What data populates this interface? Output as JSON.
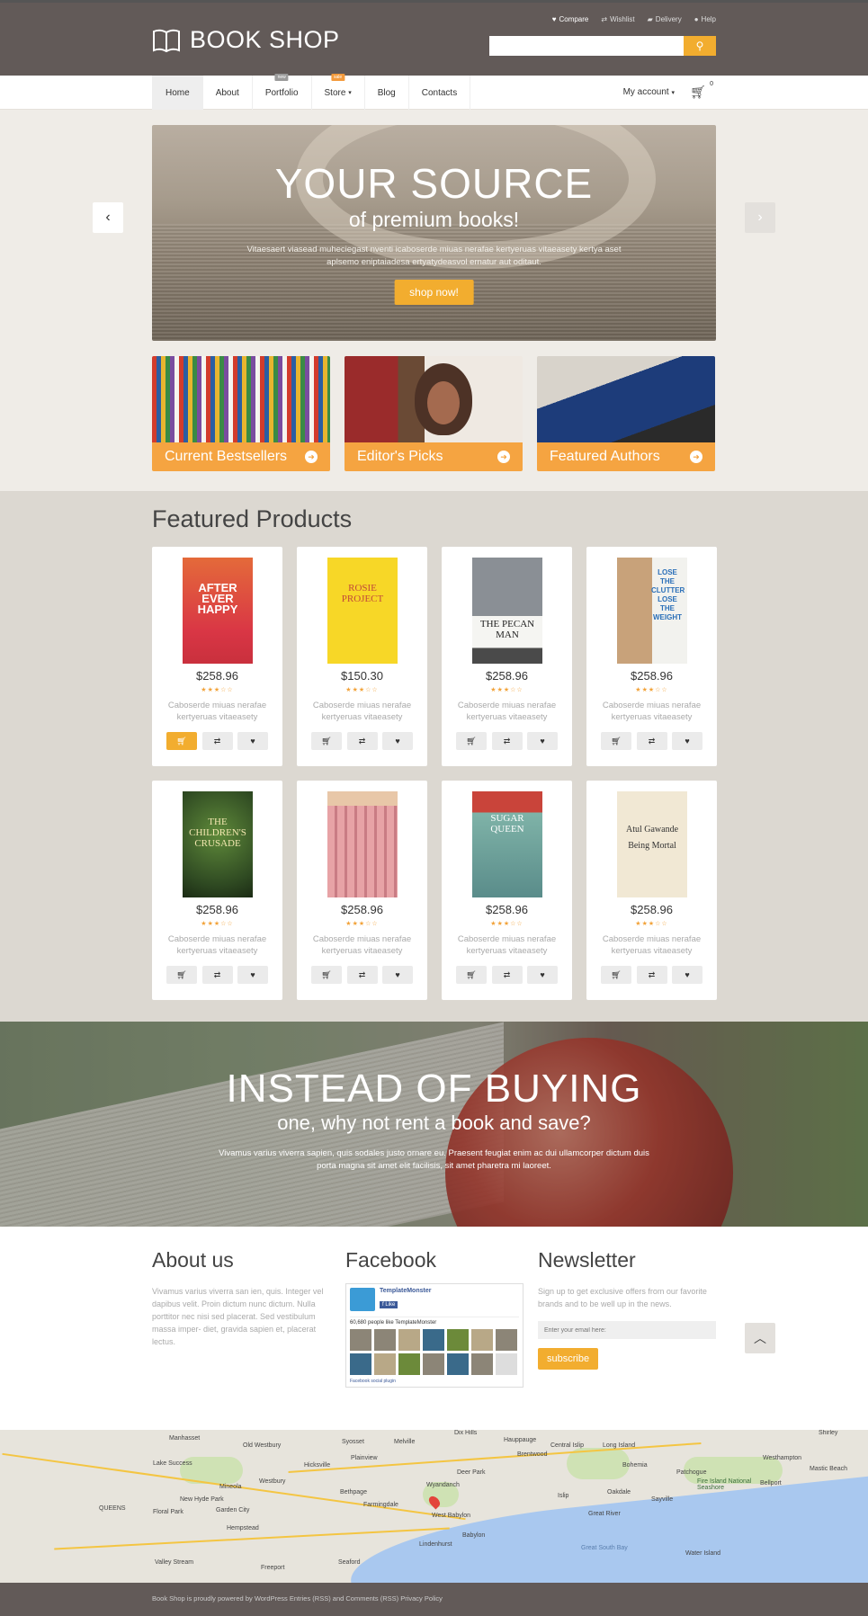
{
  "header": {
    "logo": "BOOK SHOP",
    "toplinks": [
      "Compare",
      "Wishlist",
      "Delivery",
      "Help"
    ],
    "search_placeholder": ""
  },
  "nav": {
    "items": [
      "Home",
      "About",
      "Portfolio",
      "Store",
      "Blog",
      "Contacts"
    ],
    "portfolio_badge": "new",
    "store_badge": "sale",
    "my_account": "My account",
    "cart_count": "0"
  },
  "hero": {
    "title": "YOUR SOURCE",
    "subtitle": "of premium books!",
    "text": "Vitaesaert viasead muheciegast nventi icaboserde miuas nerafae kertyeruas vitaeasety kertya aset aplsemo eniptaiadesa ertyatydeasvol ernatur aut oditaut.",
    "button": "shop now!"
  },
  "categories": [
    "Current  Bestsellers",
    "Editor's Picks",
    "Featured Authors"
  ],
  "featured": {
    "title": "Featured Products",
    "products": [
      {
        "cover": "AFTER EVER HAPPY",
        "price": "$258.96",
        "desc": "Caboserde miuas nerafae kertyeruas vitaeasety"
      },
      {
        "cover": "ROSIE PROJECT",
        "price": "$150.30",
        "desc": "Caboserde miuas nerafae kertyeruas vitaeasety"
      },
      {
        "cover": "THE PECAN MAN",
        "price": "$258.96",
        "desc": "Caboserde miuas nerafae kertyeruas vitaeasety"
      },
      {
        "cover": "LOSE THE CLUTTER LOSE THE WEIGHT",
        "price": "$258.96",
        "desc": "Caboserde miuas nerafae kertyeruas vitaeasety"
      },
      {
        "cover": "THE CHILDREN'S CRUSADE",
        "price": "$258.96",
        "desc": "Caboserde miuas nerafae kertyeruas vitaeasety"
      },
      {
        "cover": "",
        "price": "$258.96",
        "desc": "Caboserde miuas nerafae kertyeruas vitaeasety"
      },
      {
        "cover": "SUGAR QUEEN",
        "price": "$258.96",
        "desc": "Caboserde miuas nerafae kertyeruas vitaeasety"
      },
      {
        "cover": "Atul Gawande Being Mortal",
        "price": "$258.96",
        "desc": "Caboserde miuas nerafae kertyeruas vitaeasety"
      }
    ]
  },
  "banner": {
    "title": "INSTEAD OF BUYING",
    "subtitle": "one, why not rent a book and save?",
    "text": "Vivamus varius viverra sapien, quis sodales justo ornare eu. Praesent feugiat enim ac dui ullamcorper dictum duis porta magna sit amet elit facilisis, sit amet pharetra mi laoreet."
  },
  "about": {
    "title": "About us",
    "text": "Vivamus varius viverra san ien, quis. Integer vel dapibus velit. Proin dictum nunc dictum. Nulla porttitor nec nisi sed placerat. Sed vestibulum massa imper- diet, gravida sapien et, placerat lectus."
  },
  "facebook": {
    "title": "Facebook",
    "page": "TemplateMonster",
    "like": "Like",
    "count": "60,680 people like TemplateMonster",
    "plugin": "Facebook social plugin"
  },
  "newsletter": {
    "title": "Newsletter",
    "text": "Sign up to get exclusive offers from our favorite brands and to be well up in the news.",
    "placeholder": "Enter your email here:",
    "button": "subscribe"
  },
  "map": {
    "labels": [
      "Manhasset",
      "Old Westbury",
      "Syosset",
      "Melville",
      "Dix Hills",
      "Brentwood",
      "Central Islip",
      "Long Island",
      "Lake Success",
      "Hicksville",
      "Plainview",
      "Deer Park",
      "Bohemia",
      "Patchogue",
      "Westhampton",
      "Mineola",
      "Westbury",
      "Bethpage",
      "Farmingdale",
      "Wyandanch",
      "Sayville",
      "Oakdale",
      "Bellport",
      "Garden City",
      "QUEENS",
      "West Babylon",
      "Great River",
      "Hempstead",
      "Freeport",
      "Lindenhurst",
      "Babylon",
      "Valley Stream",
      "Seaford",
      "Water Island",
      "Great South Bay",
      "Floral Park",
      "New Hyde Park",
      "Fire Island National Seashore",
      "Shirley",
      "Mastic Beach",
      "Hauppauge",
      "Islip"
    ]
  },
  "footer": {
    "text": "Book Shop is proudly powered by WordPress Entries (RSS) and Comments (RSS) Privacy Policy"
  }
}
